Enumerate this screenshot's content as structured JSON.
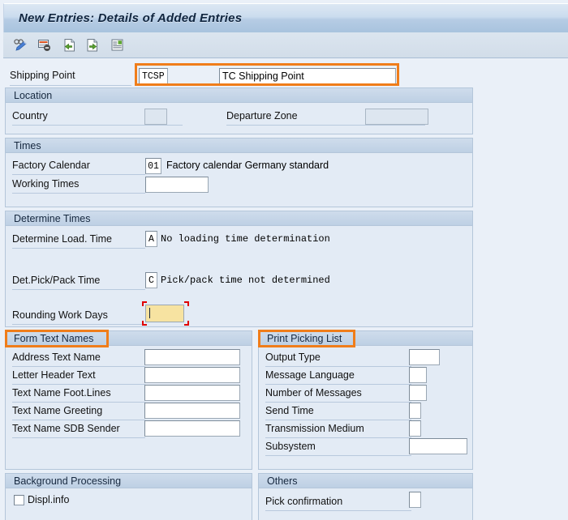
{
  "window": {
    "title": "New Entries: Details of Added Entries"
  },
  "toolbar": {
    "buttons": [
      {
        "name": "display-change-icon",
        "label": "Display/Change"
      },
      {
        "name": "new-entries-icon",
        "label": "New Entries"
      },
      {
        "name": "copy-as-icon",
        "label": "Copy As..."
      },
      {
        "name": "delete-entry-icon",
        "label": "Delete"
      },
      {
        "name": "select-all-icon",
        "label": "Print Standard List"
      }
    ]
  },
  "header": {
    "shipping_point_label": "Shipping Point",
    "shipping_point_code": "TCSP",
    "shipping_point_name": "TC Shipping Point"
  },
  "panels": {
    "location": {
      "title": "Location",
      "fields": [
        {
          "label": "Country",
          "value": ""
        },
        {
          "label": "Departure Zone",
          "value": ""
        }
      ]
    },
    "times": {
      "title": "Times",
      "fields": [
        {
          "label": "Factory Calendar",
          "value": "01",
          "description": "Factory calendar Germany standard"
        },
        {
          "label": "Working Times",
          "value": ""
        }
      ]
    },
    "determine_times": {
      "title": "Determine Times",
      "fields": [
        {
          "label": "Determine Load. Time",
          "value": "A",
          "description": "No loading time determination"
        },
        {
          "label": "Det.Pick/Pack Time",
          "value": "C",
          "description": "Pick/pack time not determined"
        },
        {
          "label": "Rounding Work Days",
          "value": "",
          "description": ""
        }
      ]
    },
    "form_text_names": {
      "title": "Form Text Names",
      "fields": [
        {
          "label": "Address Text Name",
          "value": ""
        },
        {
          "label": "Letter Header Text",
          "value": ""
        },
        {
          "label": "Text Name Foot.Lines",
          "value": ""
        },
        {
          "label": "Text Name Greeting",
          "value": ""
        },
        {
          "label": "Text Name SDB Sender",
          "value": ""
        }
      ]
    },
    "print_picking_list": {
      "title": "Print Picking List",
      "fields": [
        {
          "label": "Output Type",
          "value": ""
        },
        {
          "label": "Message Language",
          "value": ""
        },
        {
          "label": "Number of Messages",
          "value": ""
        },
        {
          "label": "Send Time",
          "value": ""
        },
        {
          "label": "Transmission Medium",
          "value": ""
        },
        {
          "label": "Subsystem",
          "value": ""
        }
      ]
    },
    "background_processing": {
      "title": "Background Processing",
      "fields": [
        {
          "label": "Displ.info",
          "checked": false
        }
      ]
    },
    "others": {
      "title": "Others",
      "fields": [
        {
          "label": "Pick confirmation",
          "value": ""
        }
      ]
    }
  },
  "colors": {
    "highlight": "#f07d1a",
    "focus_field_bg": "#f7e3a1",
    "focus_marker": "#e00000",
    "panel_bg": "#e3ebf5",
    "panel_header": "#bed0e4"
  }
}
